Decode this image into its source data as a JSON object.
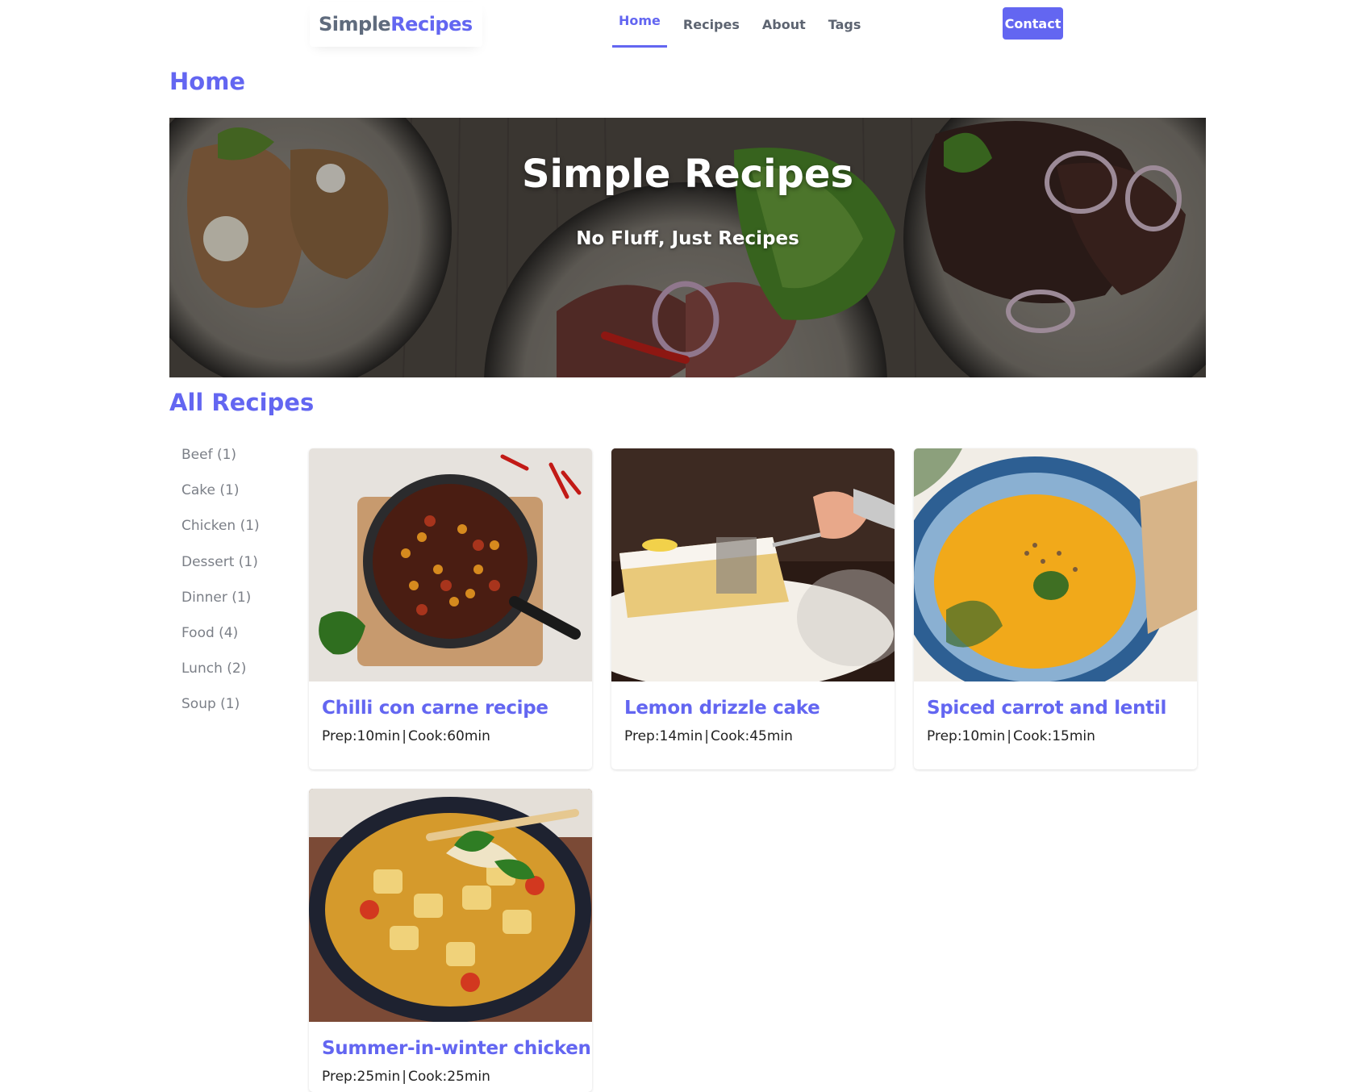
{
  "brand": {
    "part1": "Simple",
    "part2": "Recipes"
  },
  "nav": {
    "links": [
      {
        "label": "Home"
      },
      {
        "label": "Recipes"
      },
      {
        "label": "About"
      },
      {
        "label": "Tags"
      }
    ],
    "contact_label": "Contact"
  },
  "page_title": "Home",
  "hero": {
    "title": "Simple Recipes",
    "subtitle": "No Fluff, Just Recipes"
  },
  "all_recipes": {
    "title": "All Recipes",
    "tags": [
      {
        "label": "Beef (1)"
      },
      {
        "label": "Cake (1)"
      },
      {
        "label": "Chicken (1)"
      },
      {
        "label": "Dessert (1)"
      },
      {
        "label": "Dinner (1)"
      },
      {
        "label": "Food (4)"
      },
      {
        "label": "Lunch (2)"
      },
      {
        "label": "Soup (1)"
      }
    ],
    "recipes": [
      {
        "title": "Chilli con carne recipe",
        "prep": "Prep:10min",
        "cook": "Cook:60min"
      },
      {
        "title": "Lemon drizzle cake",
        "prep": "Prep:14min",
        "cook": "Cook:45min"
      },
      {
        "title": "Spiced carrot and lentil",
        "prep": "Prep:10min",
        "cook": "Cook:15min"
      },
      {
        "title": "Summer-in-winter chicken",
        "prep": "Prep:25min",
        "cook": "Cook:25min"
      }
    ]
  },
  "colors": {
    "accent": "#6366f1",
    "nav_text": "#5d6471",
    "tag_text": "#7b7f87"
  }
}
